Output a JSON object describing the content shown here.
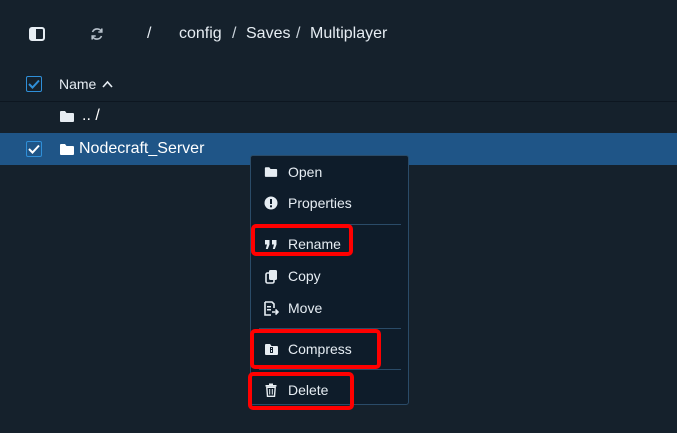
{
  "toolbar": {
    "breadcrumb": {
      "root": "/",
      "parts": [
        "config",
        "Saves",
        "Multiplayer"
      ],
      "separator": "/"
    }
  },
  "table": {
    "header": {
      "name": "Name"
    },
    "rows": [
      {
        "label": ".. /",
        "selected": false,
        "checkbox": false
      },
      {
        "label": "Nodecraft_Server",
        "selected": true,
        "checkbox": true
      }
    ]
  },
  "context_menu": {
    "items": [
      {
        "label": "Open",
        "icon": "folder-icon"
      },
      {
        "label": "Properties",
        "icon": "info-circle-icon"
      },
      {
        "label": "Rename",
        "icon": "quote-icon"
      },
      {
        "label": "Copy",
        "icon": "copy-icon"
      },
      {
        "label": "Move",
        "icon": "move-icon"
      },
      {
        "label": "Compress",
        "icon": "archive-icon"
      },
      {
        "label": "Delete",
        "icon": "trash-icon"
      }
    ]
  },
  "colors": {
    "background": "#15212c",
    "selected_row": "#1f5587",
    "menu_background": "#0e1c2a",
    "accent": "#2f8fd8",
    "highlight": "#ff0000"
  }
}
